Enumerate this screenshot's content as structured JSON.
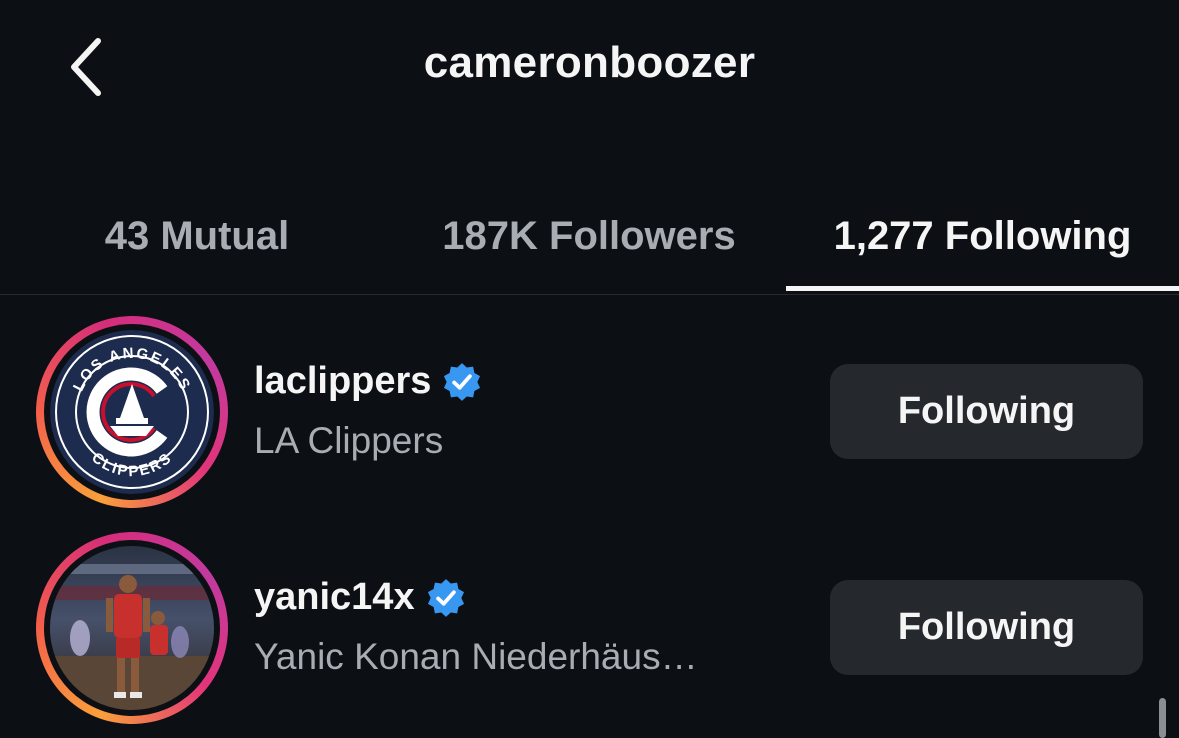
{
  "header": {
    "title": "cameronboozer",
    "back_icon": "chevron-left-icon"
  },
  "tabs": [
    {
      "label": "43 Mutual",
      "active": false
    },
    {
      "label": "187K Followers",
      "active": false
    },
    {
      "label": "1,277 Following",
      "active": true
    }
  ],
  "list": [
    {
      "username": "laclippers",
      "full_name": "LA Clippers",
      "verified": true,
      "button_label": "Following",
      "avatar_text_top": "LOS ANGELES",
      "avatar_text_bottom": "CLIPPERS"
    },
    {
      "username": "yanic14x",
      "full_name": "Yanic Konan Niederhäus…",
      "verified": true,
      "button_label": "Following"
    }
  ],
  "colors": {
    "background": "#0c1014",
    "text_primary": "#f5f5f5",
    "text_secondary": "#a8acb3",
    "button_bg": "#25292e",
    "verified_blue": "#3897f0",
    "story_ring_start": "#f9a03a",
    "story_ring_end": "#c13a9f",
    "clippers_navy": "#1d2b4f"
  }
}
